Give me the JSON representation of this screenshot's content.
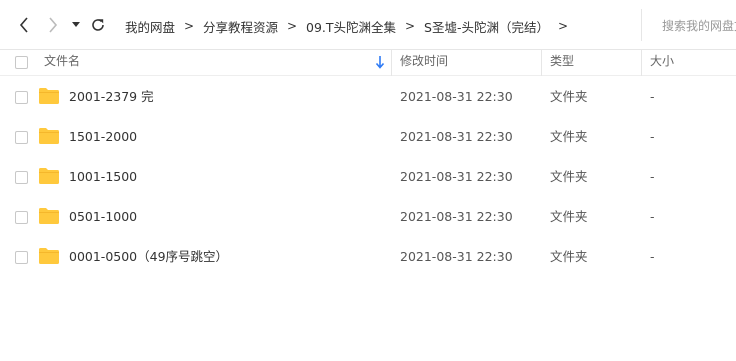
{
  "navbar": {
    "back_icon": "back-arrow-icon",
    "forward_icon": "forward-arrow-icon",
    "history_icon": "dropdown-caret-icon",
    "refresh_icon": "refresh-icon",
    "breadcrumbs": [
      "我的网盘",
      "分享教程资源",
      "09.T头陀渊全集",
      "S圣墟-头陀渊（完结）"
    ],
    "separator": ">",
    "search_placeholder": "搜索我的网盘文件"
  },
  "table": {
    "columns": {
      "name": "文件名",
      "modified": "修改时间",
      "type": "类型",
      "size": "大小"
    },
    "sort_icon": "sort-down-arrow-icon",
    "rows": [
      {
        "name": "2001-2379 完",
        "modified": "2021-08-31 22:30",
        "type": "文件夹",
        "size": "-"
      },
      {
        "name": "1501-2000",
        "modified": "2021-08-31 22:30",
        "type": "文件夹",
        "size": "-"
      },
      {
        "name": "1001-1500",
        "modified": "2021-08-31 22:30",
        "type": "文件夹",
        "size": "-"
      },
      {
        "name": "0501-1000",
        "modified": "2021-08-31 22:30",
        "type": "文件夹",
        "size": "-"
      },
      {
        "name": "0001-0500（49序号跳空）",
        "modified": "2021-08-31 22:30",
        "type": "文件夹",
        "size": "-"
      }
    ]
  },
  "colors": {
    "folder": "#ffc93d",
    "sort_arrow": "#2f7bf5",
    "border": "#e6e6e6",
    "text": "#333333"
  }
}
